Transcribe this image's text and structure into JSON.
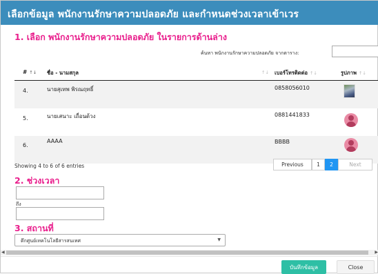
{
  "modal": {
    "title": "เลือกข้อมูล พนักงานรักษาความปลอดภัย และกำหนดช่วงเวลาเข้าเวร",
    "header_color": "#3c8dbc"
  },
  "section1": {
    "title": "1. เลือก พนักงานรักษาความปลอดภัย ในรายการด้านล่าง",
    "search_label": "ค้นหา พนักงานรักษาความปลอดภัย จากตาราง:",
    "search_value": ""
  },
  "table": {
    "columns": [
      {
        "label": "#",
        "sort": "↑↓"
      },
      {
        "label": "ชื่อ - นามสกุล",
        "sort": "↑↓"
      },
      {
        "label": "เบอร์โทรติดต่อ",
        "sort": "↑↓"
      },
      {
        "label": "รูปภาพ",
        "sort": "↑↓"
      }
    ],
    "rows": [
      {
        "num": "4.",
        "name": "นายสุเทพ พิรณฤทธิ์",
        "phone": "0858056010",
        "avatar": "photo"
      },
      {
        "num": "5.",
        "name": "นายเสนาะ เถื่อนด้วง",
        "phone": "0881441833",
        "avatar": "user-icon"
      },
      {
        "num": "6.",
        "name": "AAAA",
        "phone": "BBBB",
        "avatar": "user-icon"
      }
    ],
    "info": "Showing 4 to 6 of 6 entries",
    "pagination": {
      "previous": "Previous",
      "pages": [
        "1",
        "2"
      ],
      "current_page": "2",
      "next": "Next"
    }
  },
  "section2": {
    "title": "2. ช่วงเวลา",
    "start_value": "",
    "to_label": "ถึง",
    "end_value": ""
  },
  "section3": {
    "title": "3. สถานที่",
    "selected_location": "ตึกศูนย์เทคโนโลยีสารสนเทศ"
  },
  "footer": {
    "save_label": "บันทึกข้อมูล",
    "close_label": "Close",
    "save_color": "#2ebfa5"
  },
  "colors": {
    "section_title": "#e91e8c",
    "pagination_active": "#2196f3"
  }
}
